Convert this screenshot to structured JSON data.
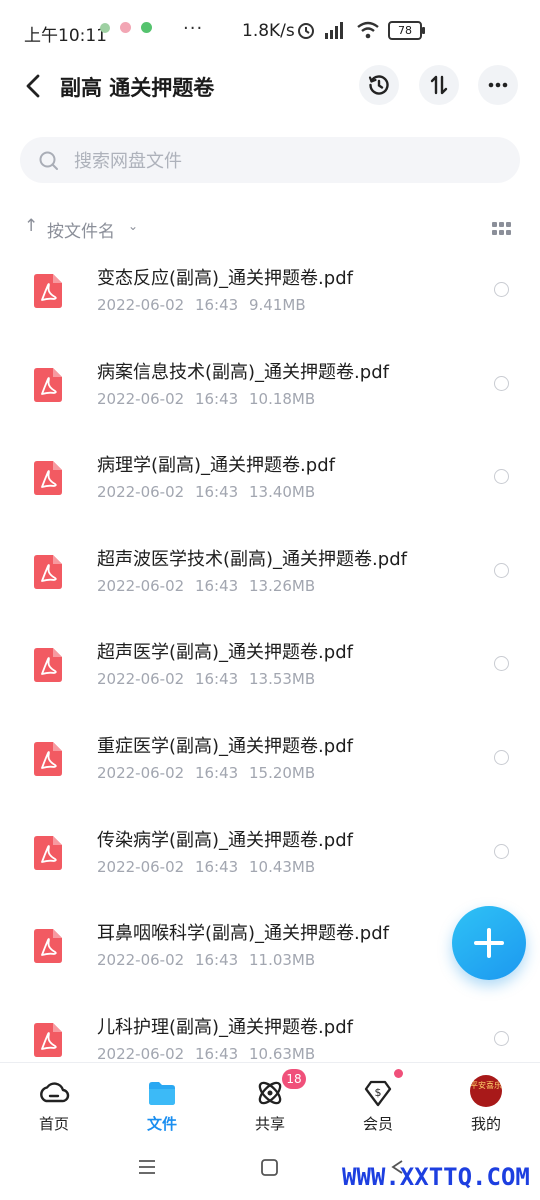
{
  "status_bar": {
    "time": "上午10:11",
    "more": "···",
    "net_speed": "1.8K/s",
    "battery": "78"
  },
  "header": {
    "title": "副高 通关押题卷",
    "icons": [
      "back-chevron-icon",
      "history-clock-icon",
      "sort-swap-icon",
      "more-dots-icon"
    ]
  },
  "search": {
    "placeholder": "搜索网盘文件"
  },
  "sort": {
    "arrow": "↑",
    "label": "按文件名",
    "chevron": "⌄"
  },
  "files": [
    {
      "name": "变态反应(副高)_通关押题卷.pdf",
      "date": "2022-06-02",
      "time": "16:43",
      "size": "9.41MB"
    },
    {
      "name": "病案信息技术(副高)_通关押题卷.pdf",
      "date": "2022-06-02",
      "time": "16:43",
      "size": "10.18MB"
    },
    {
      "name": "病理学(副高)_通关押题卷.pdf",
      "date": "2022-06-02",
      "time": "16:43",
      "size": "13.40MB"
    },
    {
      "name": "超声波医学技术(副高)_通关押题卷.pdf",
      "date": "2022-06-02",
      "time": "16:43",
      "size": "13.26MB"
    },
    {
      "name": "超声医学(副高)_通关押题卷.pdf",
      "date": "2022-06-02",
      "time": "16:43",
      "size": "13.53MB"
    },
    {
      "name": "重症医学(副高)_通关押题卷.pdf",
      "date": "2022-06-02",
      "time": "16:43",
      "size": "15.20MB"
    },
    {
      "name": "传染病学(副高)_通关押题卷.pdf",
      "date": "2022-06-02",
      "time": "16:43",
      "size": "10.43MB"
    },
    {
      "name": "耳鼻咽喉科学(副高)_通关押题卷.pdf",
      "date": "2022-06-02",
      "time": "16:43",
      "size": "11.03MB"
    },
    {
      "name": "儿科护理(副高)_通关押题卷.pdf",
      "date": "2022-06-02",
      "time": "16:43",
      "size": "10.63MB"
    }
  ],
  "bottom_nav": {
    "items": [
      {
        "label": "首页",
        "icon": "cloud-home-icon"
      },
      {
        "label": "文件",
        "icon": "folder-icon"
      },
      {
        "label": "共享",
        "icon": "share-atom-icon"
      },
      {
        "label": "会员",
        "icon": "vip-diamond-icon"
      },
      {
        "label": "我的",
        "icon": "avatar"
      }
    ],
    "active_index": 1,
    "share_badge": "18",
    "avatar_text": "平安喜乐"
  },
  "colors": {
    "accent": "#1a8ef0",
    "pdf_red": "#f25a62",
    "badge": "#f0507a"
  },
  "watermark": "WWW.XXTTQ.COM"
}
